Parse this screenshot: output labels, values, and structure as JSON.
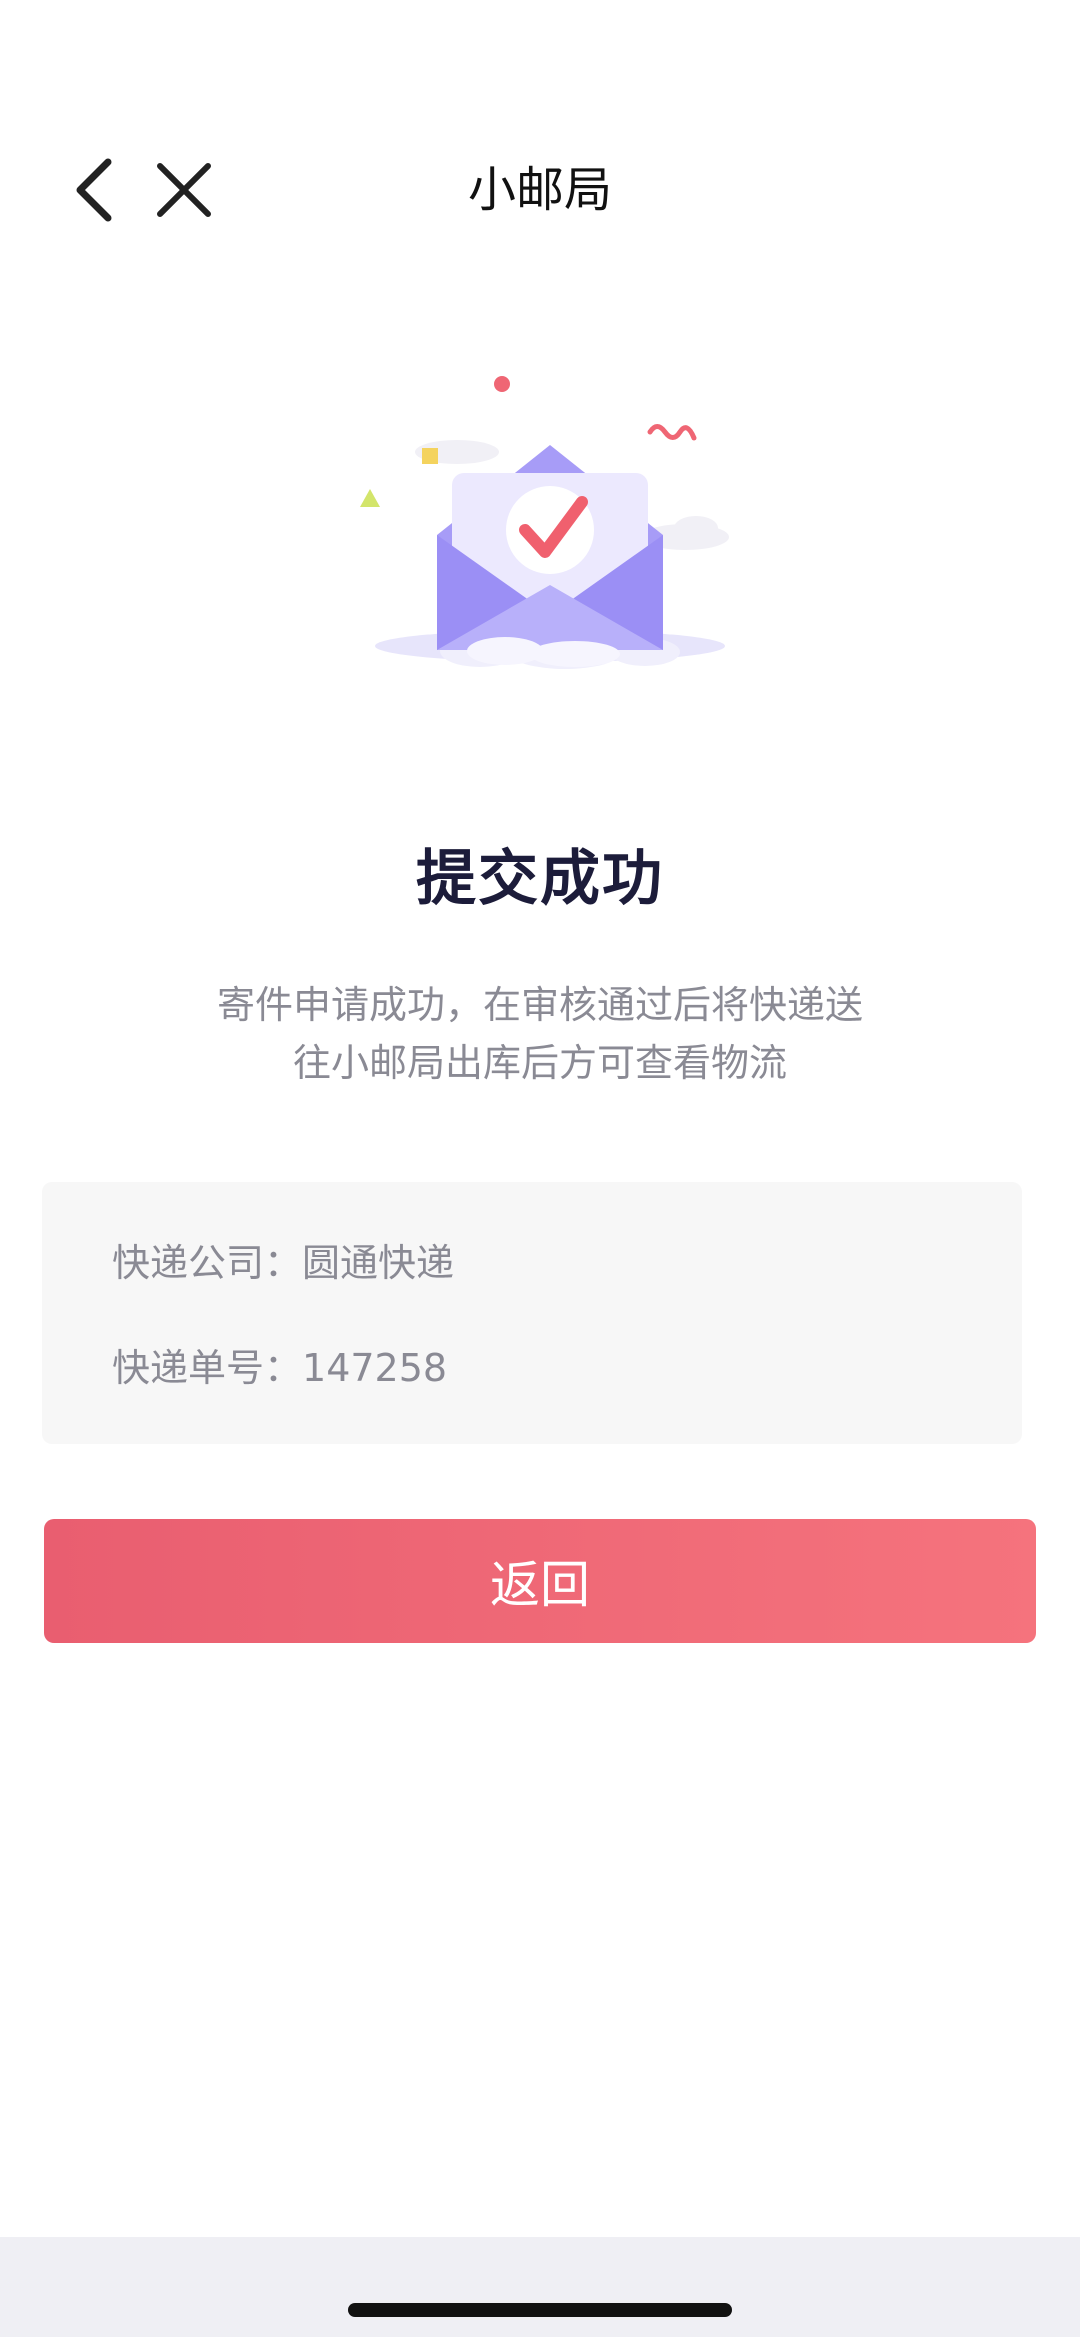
{
  "nav": {
    "title": "小邮局",
    "back_icon": "chevron-left-icon",
    "close_icon": "close-icon"
  },
  "illustration": {
    "icon": "envelope-checkmark-icon",
    "colors": {
      "envelope": "#9b8ff5",
      "check": "#f0606e",
      "cloud": "#e7e5fb"
    }
  },
  "result": {
    "title": "提交成功",
    "description_line1": "寄件申请成功，在审核通过后将快递送",
    "description_line2": "往小邮局出库后方可查看物流"
  },
  "info": {
    "company_label": "快递公司：",
    "company_value": "圆通快递",
    "tracking_label": "快递单号：",
    "tracking_value": "147258"
  },
  "actions": {
    "return_label": "返回"
  },
  "colors": {
    "accent": "#ef6674",
    "card_bg": "#f7f7f7",
    "secondary_text": "#8a8a94"
  }
}
